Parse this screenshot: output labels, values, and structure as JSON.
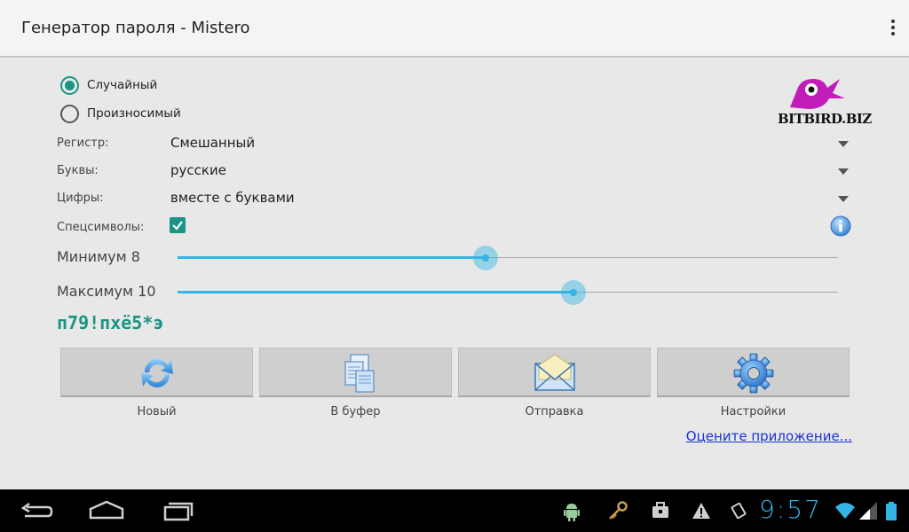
{
  "app": {
    "title": "Генератор пароля - Mistero",
    "menu_icon": "overflow-menu-icon"
  },
  "mode": {
    "options": [
      {
        "label": "Случайный",
        "checked": true
      },
      {
        "label": "Произносимый",
        "checked": false
      }
    ]
  },
  "logo": {
    "text": "BITBIRD.BIZ",
    "icon": "bird-logo"
  },
  "settings": {
    "register": {
      "label": "Регистр:",
      "value": "Смешанный"
    },
    "letters": {
      "label": "Буквы:",
      "value": "русские"
    },
    "digits": {
      "label": "Цифры:",
      "value": "вместе с буквами"
    },
    "special": {
      "label": "Спецсимволы:",
      "checked": true
    }
  },
  "sliders": {
    "min": {
      "label": "Минимум 8",
      "fraction": 0.466
    },
    "max": {
      "label": "Максимум 10",
      "fraction": 0.6
    }
  },
  "password": "п79!пхё5*э",
  "buttons": {
    "new": {
      "label": "Новый",
      "icon": "refresh-icon"
    },
    "copy": {
      "label": "В буфер",
      "icon": "copy-icon"
    },
    "send": {
      "label": "Отправка",
      "icon": "mail-icon"
    },
    "settings": {
      "label": "Настройки",
      "icon": "gear-icon"
    }
  },
  "rate_link": "Оцените приложение...",
  "statusbar": {
    "time": "9:57",
    "icons": [
      "android-icon",
      "key-icon",
      "briefcase-icon",
      "warning-icon",
      "rotate-icon",
      "wifi-icon",
      "battery-icon"
    ]
  },
  "colors": {
    "accent": "#1a9484",
    "holo_blue": "#33b5e5",
    "link": "#1a31d6"
  }
}
